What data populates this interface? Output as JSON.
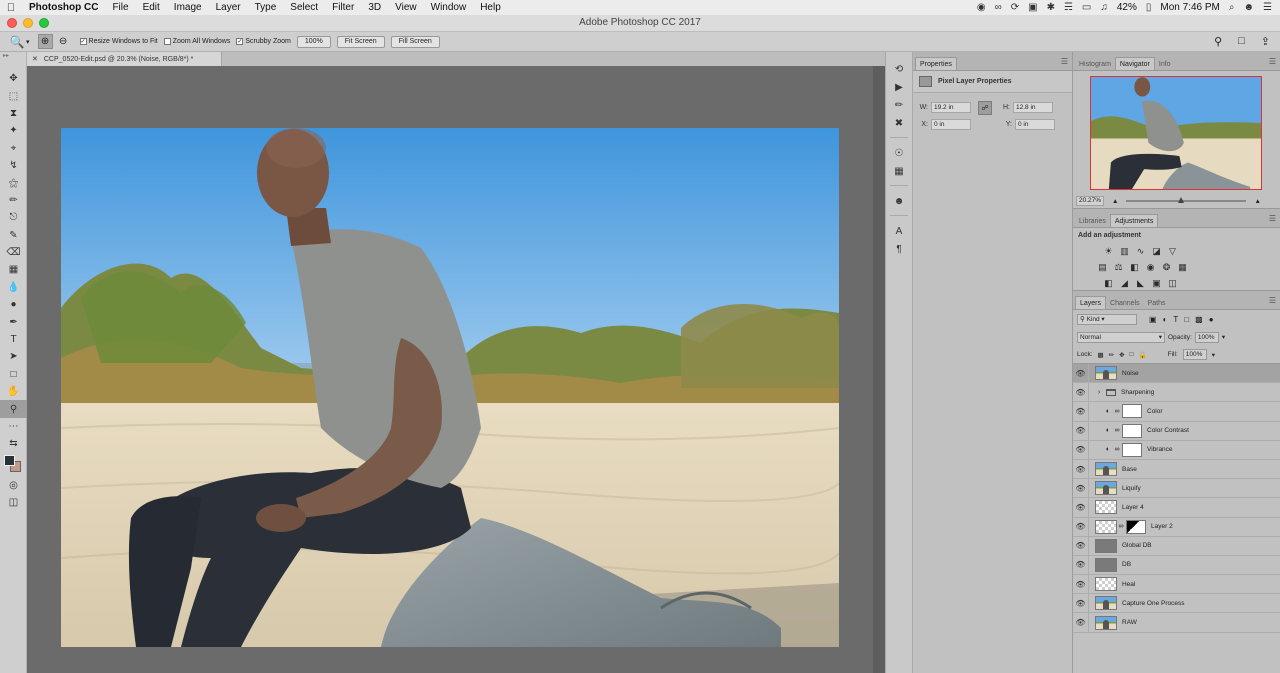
{
  "menubar": {
    "app_name": "Photoshop CC",
    "items": [
      "File",
      "Edit",
      "Image",
      "Layer",
      "Type",
      "Select",
      "Filter",
      "3D",
      "View",
      "Window",
      "Help"
    ],
    "battery": "42%",
    "clock": "Mon 7:46 PM"
  },
  "window": {
    "title": "Adobe Photoshop CC 2017"
  },
  "options_bar": {
    "resize_windows": "Resize Windows to Fit",
    "zoom_all": "Zoom All Windows",
    "scrubby": "Scrubby Zoom",
    "btn_100": "100%",
    "btn_fit": "Fit Screen",
    "btn_fill": "Fill Screen"
  },
  "document": {
    "tab_title": "CCP_0520-Edit.psd @ 20.3% (Noise, RGB/8*) *"
  },
  "properties": {
    "tab_label": "Properties",
    "header": "Pixel Layer Properties",
    "w_label": "W:",
    "w_value": "19.2 in",
    "h_label": "H:",
    "h_value": "12.8 in",
    "x_label": "X:",
    "x_value": "0 in",
    "y_label": "Y:",
    "y_value": "0 in"
  },
  "navigator": {
    "tabs": [
      "Histogram",
      "Navigator",
      "Info"
    ],
    "zoom": "20.27%"
  },
  "adjustments": {
    "tabs": [
      "Libraries",
      "Adjustments"
    ],
    "title": "Add an adjustment"
  },
  "layers": {
    "tabs": [
      "Layers",
      "Channels",
      "Paths"
    ],
    "kind": "Kind",
    "blend_mode": "Normal",
    "opacity_label": "Opacity:",
    "opacity": "100%",
    "lock_label": "Lock:",
    "fill_label": "Fill:",
    "fill": "100%",
    "items": [
      {
        "name": "Noise"
      },
      {
        "name": "Sharpening"
      },
      {
        "name": "Color"
      },
      {
        "name": "Color Contrast"
      },
      {
        "name": "Vibrance"
      },
      {
        "name": "Base"
      },
      {
        "name": "Liquify"
      },
      {
        "name": "Layer 4"
      },
      {
        "name": "Layer 2"
      },
      {
        "name": "Global DB"
      },
      {
        "name": "DB"
      },
      {
        "name": "Heal"
      },
      {
        "name": "Capture One Process"
      },
      {
        "name": "RAW"
      }
    ]
  }
}
